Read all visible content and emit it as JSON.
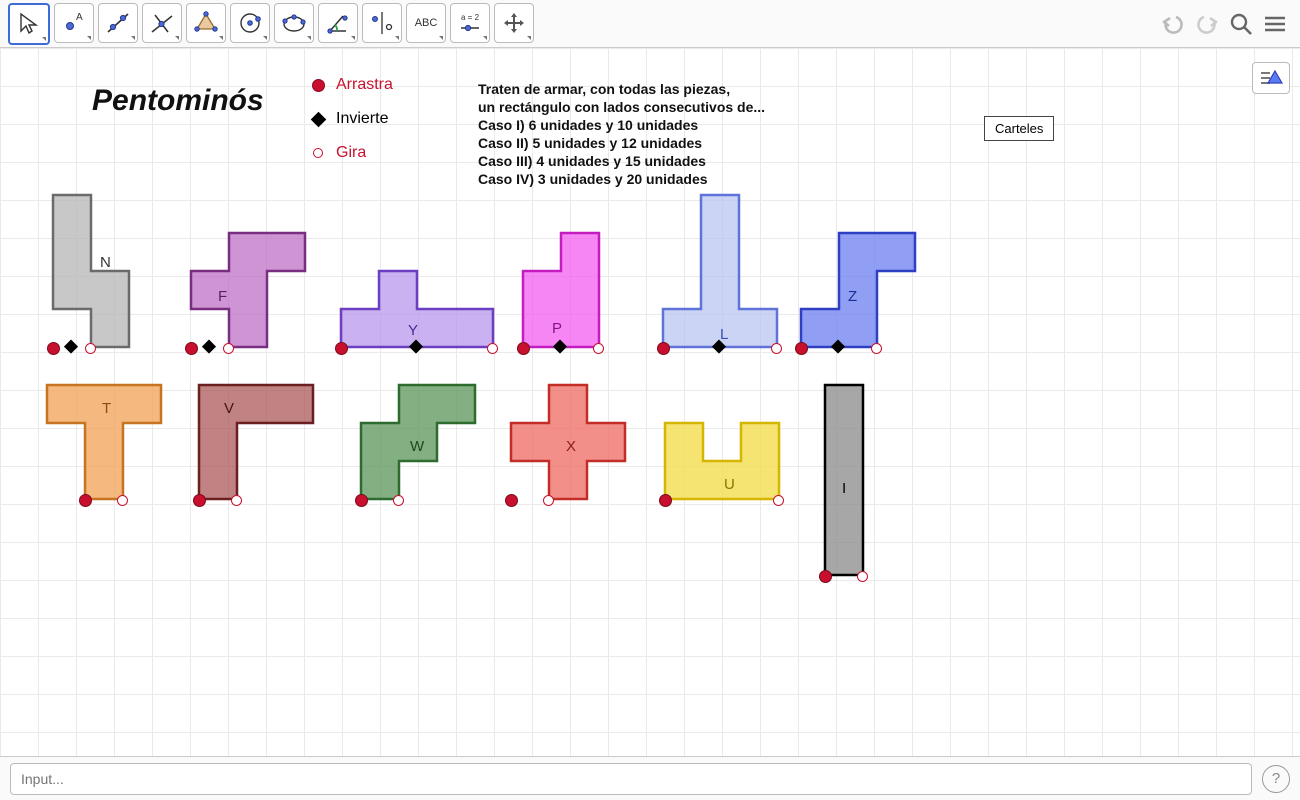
{
  "toolbar": {
    "tools": [
      {
        "name": "move-tool",
        "selected": true
      },
      {
        "name": "point-tool"
      },
      {
        "name": "line-tool"
      },
      {
        "name": "perpendicular-line-tool"
      },
      {
        "name": "polygon-tool"
      },
      {
        "name": "circle-center-point-tool"
      },
      {
        "name": "circle-three-points-tool"
      },
      {
        "name": "angle-tool"
      },
      {
        "name": "reflect-tool"
      },
      {
        "name": "text-tool",
        "text": "ABC"
      },
      {
        "name": "slider-tool",
        "text": "a = 2"
      },
      {
        "name": "move-view-tool"
      }
    ]
  },
  "title": "Pentominós",
  "legend": {
    "drag": "Arrastra",
    "flip": "Invierte",
    "rotate": "Gira"
  },
  "instructions": {
    "l1": "Traten de armar, con todas las piezas,",
    "l2": "un rectángulo con lados consecutivos de...",
    "l3": "Caso I) 6 unidades y 10 unidades",
    "l4": "Caso II) 5 unidades y 12 unidades",
    "l5": "Caso III) 4 unidades y 15 unidades",
    "l6": "Caso IV) 3 unidades y 20 unidades"
  },
  "carteles_label": "Carteles",
  "pieces": {
    "N": {
      "label": "N",
      "color": "#b6b6b6",
      "stroke": "#6b6b6b"
    },
    "F": {
      "label": "F",
      "color": "#bb6bc2",
      "stroke": "#7a2e82"
    },
    "Y": {
      "label": "Y",
      "color": "#b693eb",
      "stroke": "#6c3fc2"
    },
    "P": {
      "label": "P",
      "color": "#f453f1",
      "stroke": "#c31dc0"
    },
    "L": {
      "label": "L",
      "color": "#b9c4f3",
      "stroke": "#5f73d8"
    },
    "Z": {
      "label": "Z",
      "color": "#6b7ff0",
      "stroke": "#2e3fc2"
    },
    "T": {
      "label": "T",
      "color": "#f2a054",
      "stroke": "#c77420"
    },
    "V": {
      "label": "V",
      "color": "#a85252",
      "stroke": "#6b1f1f"
    },
    "W": {
      "label": "W",
      "color": "#5a945a",
      "stroke": "#2e6b2e"
    },
    "X": {
      "label": "X",
      "color": "#ef6a61",
      "stroke": "#c22e25"
    },
    "U": {
      "label": "U",
      "color": "#f4dd4a",
      "stroke": "#d4b600"
    },
    "I": {
      "label": "I",
      "color": "#8a8a8a",
      "stroke": "#000000"
    }
  },
  "input": {
    "placeholder": "Input..."
  },
  "help": "?"
}
